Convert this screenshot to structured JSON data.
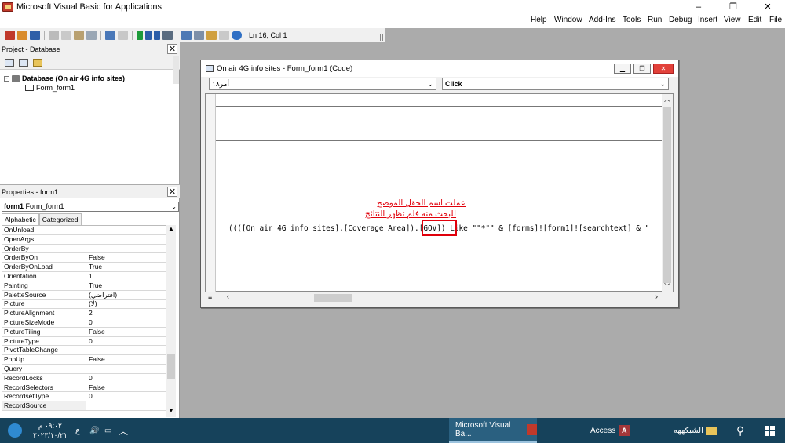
{
  "window": {
    "title": "Microsoft Visual Basic for Applications",
    "minimize": "–",
    "restore": "❐",
    "close": "✕"
  },
  "menu": {
    "items": [
      "Help",
      "Window",
      "Add-Ins",
      "Tools",
      "Run",
      "Debug",
      "Insert",
      "View",
      "Edit",
      "File"
    ]
  },
  "toolbar": {
    "cursor_position": "Ln 16, Col 1"
  },
  "project": {
    "title": "Project - Database",
    "close": "✕",
    "root": "Database (On air 4G info sites)",
    "child": "Form_form1"
  },
  "properties": {
    "title": "Properties - form1",
    "close": "✕",
    "object": "form1",
    "object_type": "Form_form1",
    "dropdown_arrow": "⌄",
    "tabs": [
      "Alphabetic",
      "Categorized"
    ],
    "rows": [
      {
        "name": "OnUnload",
        "value": ""
      },
      {
        "name": "OpenArgs",
        "value": ""
      },
      {
        "name": "OrderBy",
        "value": ""
      },
      {
        "name": "OrderByOn",
        "value": "False"
      },
      {
        "name": "OrderByOnLoad",
        "value": "True"
      },
      {
        "name": "Orientation",
        "value": "1"
      },
      {
        "name": "Painting",
        "value": "True"
      },
      {
        "name": "PaletteSource",
        "value": "(افتراضي)"
      },
      {
        "name": "Picture",
        "value": "(لا)"
      },
      {
        "name": "PictureAlignment",
        "value": "2"
      },
      {
        "name": "PictureSizeMode",
        "value": "0"
      },
      {
        "name": "PictureTiling",
        "value": "False"
      },
      {
        "name": "PictureType",
        "value": "0"
      },
      {
        "name": "PivotTableChange",
        "value": ""
      },
      {
        "name": "PopUp",
        "value": "False"
      },
      {
        "name": "Query",
        "value": ""
      },
      {
        "name": "RecordLocks",
        "value": "0"
      },
      {
        "name": "RecordSelectors",
        "value": "False"
      },
      {
        "name": "RecordsetType",
        "value": "0"
      },
      {
        "name": "RecordSource",
        "value": ""
      }
    ]
  },
  "code_window": {
    "title": "On air 4G info sites - Form_form1 (Code)",
    "object_dropdown": "أمر١٨",
    "procedure_dropdown": "Click",
    "code_line": "((([On air 4G info sites].[Coverage Area]).[GOV]) Like \"\"*\"\" & [forms]![form1]![searchtext] & \"",
    "annotation_line1": "عملت اسم الحقل الموضح",
    "annotation_line2": "للبحث منه فلم تظهر النتائج"
  },
  "taskbar": {
    "time": "٠٩:٠٢ م",
    "date": "٢٠٢٣/١٠/٢١",
    "language": "ع",
    "vba_label": "Microsoft Visual Ba...",
    "access_label": "Access",
    "folder_label": "الشبكههه",
    "search_glyph": "⚲"
  }
}
